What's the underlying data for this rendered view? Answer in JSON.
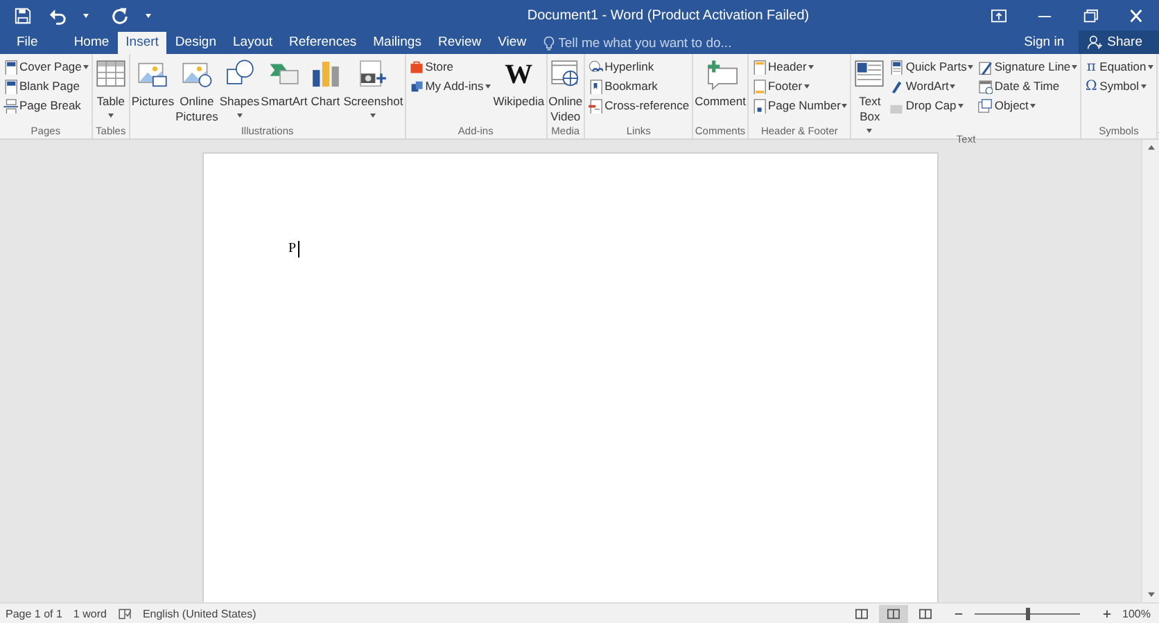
{
  "title_bar": {
    "title": "Document1 - Word (Product Activation Failed)"
  },
  "tabs": [
    {
      "label": "File",
      "selected": false
    },
    {
      "label": "Home",
      "selected": false
    },
    {
      "label": "Insert",
      "selected": true
    },
    {
      "label": "Design",
      "selected": false
    },
    {
      "label": "Layout",
      "selected": false
    },
    {
      "label": "References",
      "selected": false
    },
    {
      "label": "Mailings",
      "selected": false
    },
    {
      "label": "Review",
      "selected": false
    },
    {
      "label": "View",
      "selected": false
    }
  ],
  "tell_me": {
    "placeholder": "Tell me what you want to do..."
  },
  "account": {
    "sign_in": "Sign in",
    "share": "Share"
  },
  "ribbon": {
    "groups": [
      {
        "label": "Pages",
        "items": [
          {
            "kind": "stack",
            "items": [
              {
                "label": "Cover Page",
                "dropdown": true
              },
              {
                "label": "Blank Page",
                "dropdown": false
              },
              {
                "label": "Page Break",
                "dropdown": false
              }
            ]
          }
        ]
      },
      {
        "label": "Tables",
        "items": [
          {
            "kind": "large",
            "label": "Table",
            "dropdown": true
          }
        ]
      },
      {
        "label": "Illustrations",
        "items": [
          {
            "kind": "large",
            "label": "Pictures",
            "dropdown": false
          },
          {
            "kind": "large",
            "label": "Online Pictures",
            "dropdown": false
          },
          {
            "kind": "large",
            "label": "Shapes",
            "dropdown": true
          },
          {
            "kind": "large",
            "label": "SmartArt",
            "dropdown": false
          },
          {
            "kind": "large",
            "label": "Chart",
            "dropdown": false
          },
          {
            "kind": "large",
            "label": "Screenshot",
            "dropdown": true
          }
        ]
      },
      {
        "label": "Add-ins",
        "items": [
          {
            "kind": "stack",
            "items": [
              {
                "label": "Store",
                "dropdown": false
              },
              {
                "label": "My Add-ins",
                "dropdown": true
              }
            ]
          },
          {
            "kind": "large",
            "label": "Wikipedia",
            "glyph": "W",
            "dropdown": false
          }
        ]
      },
      {
        "label": "Media",
        "items": [
          {
            "kind": "large",
            "label": "Online Video",
            "dropdown": false
          }
        ]
      },
      {
        "label": "Links",
        "items": [
          {
            "kind": "stack",
            "items": [
              {
                "label": "Hyperlink",
                "dropdown": false
              },
              {
                "label": "Bookmark",
                "dropdown": false
              },
              {
                "label": "Cross-reference",
                "dropdown": false
              }
            ]
          }
        ]
      },
      {
        "label": "Comments",
        "items": [
          {
            "kind": "large",
            "label": "Comment",
            "dropdown": false
          }
        ]
      },
      {
        "label": "Header & Footer",
        "items": [
          {
            "kind": "stack",
            "items": [
              {
                "label": "Header",
                "dropdown": true
              },
              {
                "label": "Footer",
                "dropdown": true
              },
              {
                "label": "Page Number",
                "dropdown": true
              }
            ]
          }
        ]
      },
      {
        "label": "Text",
        "items": [
          {
            "kind": "large",
            "label": "Text Box",
            "dropdown": true
          },
          {
            "kind": "stack",
            "items": [
              {
                "label": "Quick Parts",
                "dropdown": true
              },
              {
                "label": "WordArt",
                "dropdown": true
              },
              {
                "label": "Drop Cap",
                "dropdown": true
              }
            ]
          },
          {
            "kind": "stack",
            "items": [
              {
                "label": "Signature Line",
                "dropdown": true
              },
              {
                "label": "Date & Time",
                "dropdown": false
              },
              {
                "label": "Object",
                "dropdown": true
              }
            ]
          }
        ]
      },
      {
        "label": "Symbols",
        "items": [
          {
            "kind": "stack",
            "items": [
              {
                "label": "Equation",
                "glyph": "π",
                "dropdown": true
              },
              {
                "label": "Symbol",
                "glyph": "Ω",
                "dropdown": true
              }
            ]
          }
        ]
      }
    ]
  },
  "document": {
    "text": "P"
  },
  "status_bar": {
    "page": "Page 1 of 1",
    "words": "1 word",
    "language": "English (United States)",
    "views": [
      {
        "selected": false
      },
      {
        "selected": true
      },
      {
        "selected": false
      }
    ],
    "zoom": {
      "level": 0.5,
      "reading": "100%"
    }
  }
}
